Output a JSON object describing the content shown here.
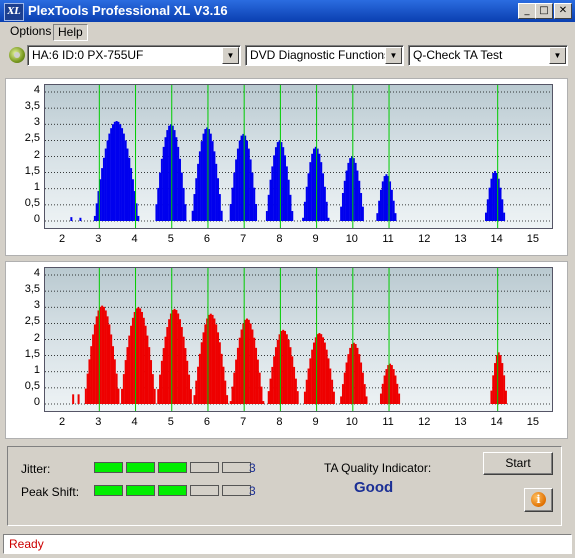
{
  "window": {
    "icon_text": "XL",
    "title": "PlexTools Professional XL V3.16",
    "minimize": "_",
    "maximize": "□",
    "close": "✕"
  },
  "menu": {
    "items": [
      "Options",
      "Help"
    ]
  },
  "toolbar": {
    "drive": "HA:6 ID:0  PX-755UF",
    "function": "DVD Diagnostic Functions",
    "test": "Q-Check TA Test",
    "dropdown_glyph": "▼"
  },
  "chart_data": [
    {
      "type": "bar",
      "color": "#0000ee",
      "ylim": [
        0,
        4.2
      ],
      "yticks": [
        "4",
        "3,5",
        "3",
        "2,5",
        "2",
        "1,5",
        "1",
        "0,5",
        "0"
      ],
      "xlim": [
        1.5,
        15.5
      ],
      "xticks": [
        "2",
        "3",
        "4",
        "5",
        "6",
        "7",
        "8",
        "9",
        "10",
        "11",
        "12",
        "13",
        "14",
        "15"
      ],
      "marker_lines": [
        3,
        4,
        5,
        6,
        7,
        8,
        9,
        10,
        11,
        14
      ],
      "peaks": [
        {
          "center": 3.45,
          "height": 3.1,
          "width": 0.62
        },
        {
          "center": 4.95,
          "height": 3.0,
          "width": 0.45
        },
        {
          "center": 5.95,
          "height": 2.9,
          "width": 0.43
        },
        {
          "center": 6.95,
          "height": 2.7,
          "width": 0.4
        },
        {
          "center": 7.95,
          "height": 2.5,
          "width": 0.38
        },
        {
          "center": 8.95,
          "height": 2.3,
          "width": 0.36
        },
        {
          "center": 9.95,
          "height": 2.0,
          "width": 0.35
        },
        {
          "center": 10.9,
          "height": 1.45,
          "width": 0.28
        },
        {
          "center": 13.9,
          "height": 1.55,
          "width": 0.28
        }
      ],
      "minor": [
        {
          "x": 2.2,
          "h": 0.12
        },
        {
          "x": 2.45,
          "h": 0.1
        }
      ]
    },
    {
      "type": "bar",
      "color": "#ee0000",
      "ylim": [
        0,
        4.2
      ],
      "yticks": [
        "4",
        "3,5",
        "3",
        "2,5",
        "2",
        "1,5",
        "1",
        "0,5",
        "0"
      ],
      "xlim": [
        1.5,
        15.5
      ],
      "xticks": [
        "2",
        "3",
        "4",
        "5",
        "6",
        "7",
        "8",
        "9",
        "10",
        "11",
        "12",
        "13",
        "14",
        "15"
      ],
      "marker_lines": [
        3,
        4,
        5,
        6,
        7,
        8,
        9,
        10,
        11,
        14
      ],
      "peaks": [
        {
          "center": 3.05,
          "height": 3.05,
          "width": 0.5
        },
        {
          "center": 4.05,
          "height": 3.0,
          "width": 0.5
        },
        {
          "center": 5.05,
          "height": 2.95,
          "width": 0.5
        },
        {
          "center": 6.05,
          "height": 2.8,
          "width": 0.48
        },
        {
          "center": 7.05,
          "height": 2.65,
          "width": 0.46
        },
        {
          "center": 8.05,
          "height": 2.3,
          "width": 0.45
        },
        {
          "center": 9.05,
          "height": 2.2,
          "width": 0.45
        },
        {
          "center": 10.0,
          "height": 1.9,
          "width": 0.38
        },
        {
          "center": 11.0,
          "height": 1.25,
          "width": 0.3
        },
        {
          "center": 14.0,
          "height": 1.6,
          "width": 0.24
        }
      ],
      "minor": [
        {
          "x": 2.25,
          "h": 0.3
        },
        {
          "x": 2.4,
          "h": 0.3
        }
      ]
    }
  ],
  "results": {
    "jitter_label": "Jitter:",
    "jitter_value": "3",
    "jitter_level": 3,
    "peak_label": "Peak Shift:",
    "peak_value": "3",
    "peak_level": 3,
    "segments_total": 5,
    "quality_label": "TA Quality Indicator:",
    "quality_value": "Good",
    "start_label": "Start",
    "info_glyph": "i"
  },
  "status": {
    "text": "Ready"
  },
  "colors": {
    "good": "#1b2f95",
    "status_text": "#cc0000",
    "meter_on": "#00ee00",
    "marker_line": "#00cc00",
    "grid": "#000000"
  }
}
